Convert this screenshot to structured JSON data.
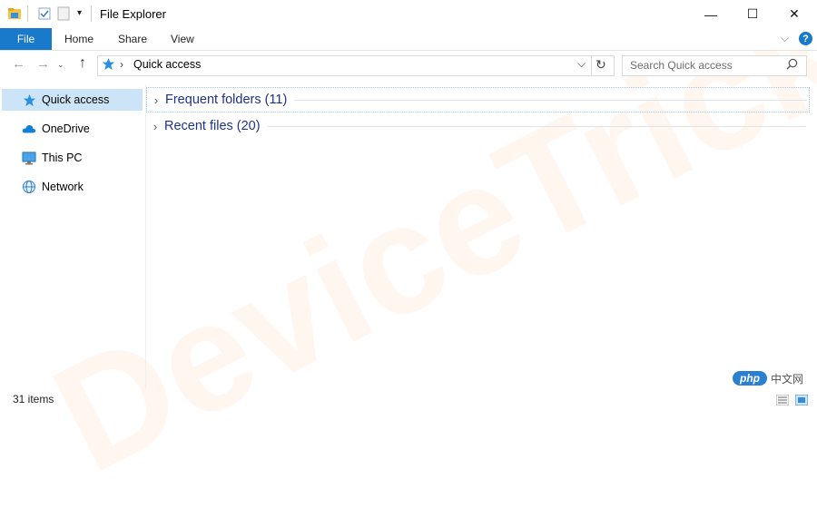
{
  "window": {
    "title": "File Explorer",
    "minimize_glyph": "—",
    "maximize_glyph": "☐",
    "close_glyph": "✕"
  },
  "ribbon": {
    "tabs": [
      {
        "label": "File"
      },
      {
        "label": "Home"
      },
      {
        "label": "Share"
      },
      {
        "label": "View"
      }
    ]
  },
  "address": {
    "location": "Quick access",
    "separator": "›"
  },
  "search": {
    "placeholder": "Search Quick access"
  },
  "sidebar": {
    "items": [
      {
        "label": "Quick access",
        "icon": "star-icon",
        "selected": true
      },
      {
        "label": "OneDrive",
        "icon": "cloud-icon"
      },
      {
        "label": "This PC",
        "icon": "monitor-icon"
      },
      {
        "label": "Network",
        "icon": "network-icon"
      }
    ]
  },
  "content": {
    "groups": [
      {
        "label": "Frequent folders (11)"
      },
      {
        "label": "Recent files (20)"
      }
    ]
  },
  "status": {
    "items_count": "31 items"
  },
  "watermark": {
    "text": "DeviceTricks"
  },
  "badge": {
    "logo_text": "php",
    "site_text": "中文网"
  },
  "colors": {
    "accent": "#1979ca",
    "selection": "#cce4f7",
    "group_text": "#1e3287",
    "help": "#1979ca"
  }
}
